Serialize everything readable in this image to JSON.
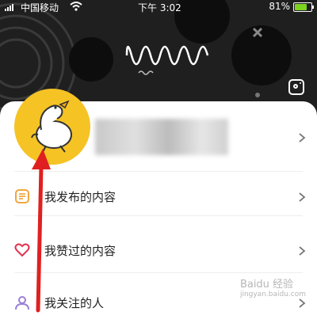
{
  "status_bar": {
    "carrier": "中国移动",
    "time": "下午 3:02",
    "battery": "81%",
    "battery_level": 0.81
  },
  "header": {
    "icons": [
      "instagram-icon"
    ],
    "background_color": "#1f1f1f"
  },
  "profile": {
    "avatar_color": "#f5c324",
    "avatar": "duck-avatar"
  },
  "menu": {
    "items": [
      {
        "label": "我发布的内容",
        "icon": "document-icon",
        "icon_color": "#f0a640"
      },
      {
        "label": "我赞过的内容",
        "icon": "heart-icon",
        "icon_color": "#e0334f"
      },
      {
        "label": "我关注的人",
        "icon": "person-icon",
        "icon_color": "#9b7fd9"
      }
    ]
  },
  "watermark": {
    "text": "Baidu 经验",
    "sub": "jingyan.baidu.com"
  },
  "annotation": {
    "color": "#e02020"
  }
}
